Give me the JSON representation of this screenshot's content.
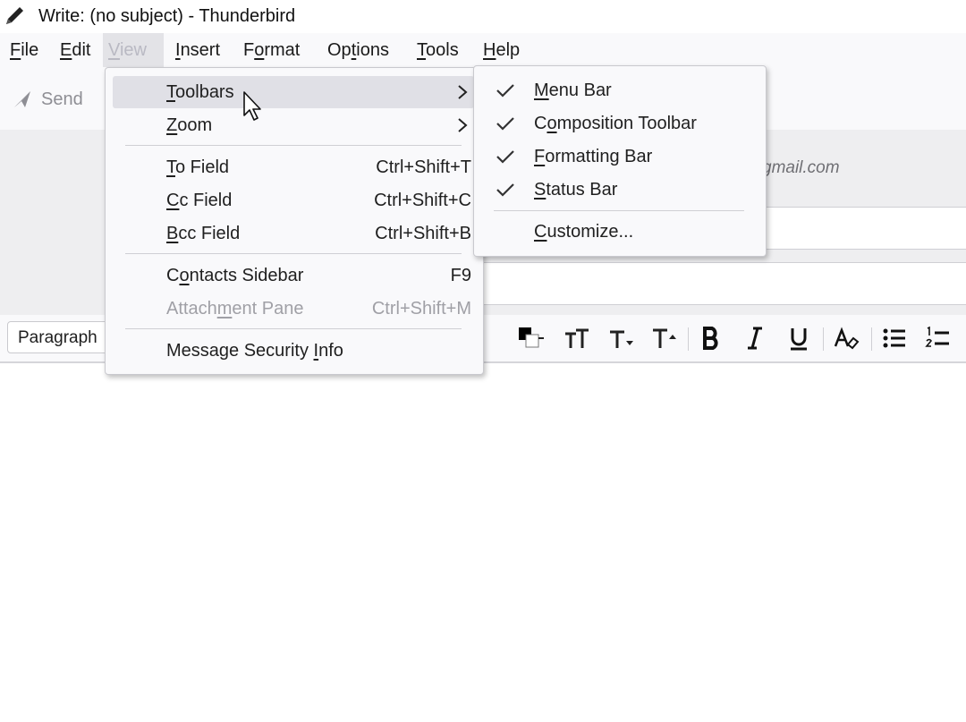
{
  "window": {
    "title": "Write: (no subject) - Thunderbird",
    "icon": "pencil-icon"
  },
  "menubar": {
    "items": [
      {
        "label": "File",
        "accel": "F",
        "rest": "ile"
      },
      {
        "label": "Edit",
        "accel": "E",
        "rest": "dit"
      },
      {
        "label": "View",
        "accel": "V",
        "rest": "iew",
        "active": true
      },
      {
        "label": "Insert",
        "accel": "I",
        "rest": "nsert"
      },
      {
        "pre": "F",
        "accel": "o",
        "rest": "rmat",
        "label": "Format"
      },
      {
        "pre": "Op",
        "accel": "t",
        "rest": "ions",
        "label": "Options"
      },
      {
        "label": "Tools",
        "accel": "T",
        "rest": "ools"
      },
      {
        "label": "Help",
        "accel": "H",
        "rest": "elp"
      }
    ]
  },
  "toolbar": {
    "send_label": "Send",
    "send_icon": "paper-plane-icon"
  },
  "compose_header": {
    "from_partial": "gmail.com"
  },
  "format_toolbar": {
    "paragraph_label": "Paragraph",
    "icons": [
      "text-color-icon",
      "font-size-icon",
      "smaller-text-icon",
      "larger-text-icon",
      "bold-icon",
      "italic-icon",
      "underline-icon",
      "remove-formatting-icon",
      "bullet-list-icon",
      "numbered-list-icon"
    ]
  },
  "view_menu": {
    "toolbars": {
      "accel": "T",
      "rest": "oolbars"
    },
    "zoom": {
      "accel": "Z",
      "rest": "oom"
    },
    "to_field": {
      "accel": "T",
      "rest": "o Field",
      "shortcut": "Ctrl+Shift+T"
    },
    "cc_field": {
      "accel": "C",
      "rest": "c Field",
      "shortcut": "Ctrl+Shift+C"
    },
    "bcc_field": {
      "accel": "B",
      "rest": "cc Field",
      "shortcut": "Ctrl+Shift+B"
    },
    "contacts_sidebar": {
      "pre": "C",
      "accel": "o",
      "rest": "ntacts Sidebar",
      "shortcut": "F9"
    },
    "attachment_pane": {
      "pre": "Attach",
      "accel": "m",
      "rest": "ent Pane",
      "shortcut": "Ctrl+Shift+M"
    },
    "message_security": {
      "pre": "Message Security ",
      "accel": "I",
      "rest": "nfo"
    }
  },
  "toolbars_submenu": {
    "menu_bar": {
      "accel": "M",
      "rest": "enu Bar",
      "checked": true
    },
    "composition_toolbar": {
      "pre": "C",
      "accel": "o",
      "rest": "mposition Toolbar",
      "checked": true
    },
    "formatting_bar": {
      "accel": "F",
      "rest": "ormatting Bar",
      "checked": true
    },
    "status_bar": {
      "accel": "S",
      "rest": "tatus Bar",
      "checked": true
    },
    "customize": {
      "accel": "C",
      "rest": "ustomize...",
      "checked": false
    }
  }
}
